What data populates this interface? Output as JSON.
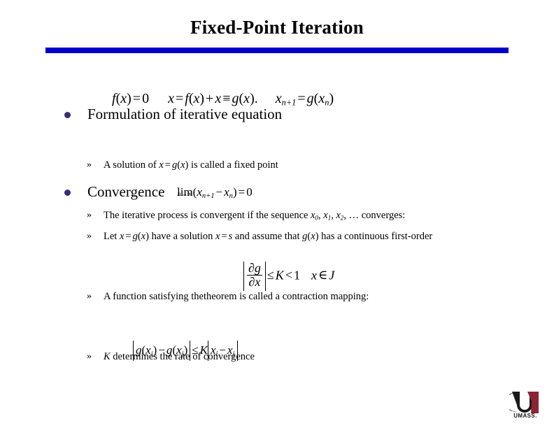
{
  "slide": {
    "title": "Fixed-Point Iteration",
    "rule_color": "#0000CC",
    "bullet_color": "#3B2A7A"
  },
  "bullets": [
    {
      "level": 1,
      "text": "Formulation of iterative equation",
      "marker": "disc"
    },
    {
      "level": 2,
      "marker": "guillemet",
      "marker_glyph": "»",
      "segments": [
        "A solution of ",
        "x",
        " = ",
        "g",
        "(",
        "x",
        ") is called a fixed point"
      ],
      "text": "A solution of x = g(x) is called a fixed point"
    },
    {
      "level": 1,
      "text": "Convergence",
      "marker": "disc"
    },
    {
      "level": 2,
      "marker": "guillemet",
      "marker_glyph": "»",
      "text": "The iterative process is convergent if the sequence x0, x1, x2, … converges:"
    },
    {
      "level": 2,
      "marker": "guillemet",
      "marker_glyph": "»",
      "text": "Let x = g(x) have a solution x = s and assume that g(x) has a continuous first-order"
    },
    {
      "level": 2,
      "marker": "guillemet",
      "marker_glyph": "»",
      "text": "A function satisfying the theorem is called a contraction mapping:"
    },
    {
      "level": 2,
      "marker": "guillemet",
      "marker_glyph": "»",
      "text": "K determines the rate of convergence"
    }
  ],
  "text_lines": {
    "formulation": "Formulation of iterative equation",
    "fixed_point_a": "A solution of ",
    "fixed_point_b": " is called a fixed point",
    "convergence": "Convergence",
    "iterative_process_a": "The iterative process is convergent if the sequence ",
    "iterative_process_b": " converges:",
    "let_a": "Let ",
    "let_b": " have a solution ",
    "let_c": " and assume that ",
    "let_d": " has a continuous first-order",
    "contraction_a": "A function satisfying the",
    "contraction_b": "theorem is called a contraction mapping:",
    "rate_a": " determines the rate of convergence"
  },
  "math": {
    "eq1": "f(x) = 0",
    "eq2": "x = f(x) + x ≡ g(x).",
    "eq3": "x_{n+1} = g(x_n)",
    "eq_limit": "lim_{n→∞}(x_{n+1} − x_n) = 0",
    "eq_derivative": "|∂g/∂x| ≤ K < 1   x ∈ J",
    "eq_lipschitz": "|g(x_i) − g(x_j)| ≤ K |x_i − x_j|",
    "tokens": {
      "f": "f",
      "g": "g",
      "x": "x",
      "s": "s",
      "K": "K",
      "J": "J",
      "n": "n",
      "zero": "0",
      "one": "1",
      "two": "2",
      "ellipsis": "…",
      "eq": "=",
      "plus": "+",
      "minus": "−",
      "equiv": "≡",
      "le": "≤",
      "lt": "<",
      "in": "∈",
      "partial": "∂",
      "lim": "lim",
      "to_infinity": "n→∞",
      "lparen": "(",
      "rparen": ")",
      "comma": ",",
      "period": ".",
      "sub_n1": "n+1",
      "sub_n": "n",
      "sub_i": "i",
      "sub_j": "j",
      "sub_0": "0",
      "sub_1": "1",
      "sub_2": "2"
    }
  },
  "logo": {
    "wordmark": "UMASS.",
    "color_maroon": "#8C2433",
    "color_dark": "#1A1A1A"
  }
}
